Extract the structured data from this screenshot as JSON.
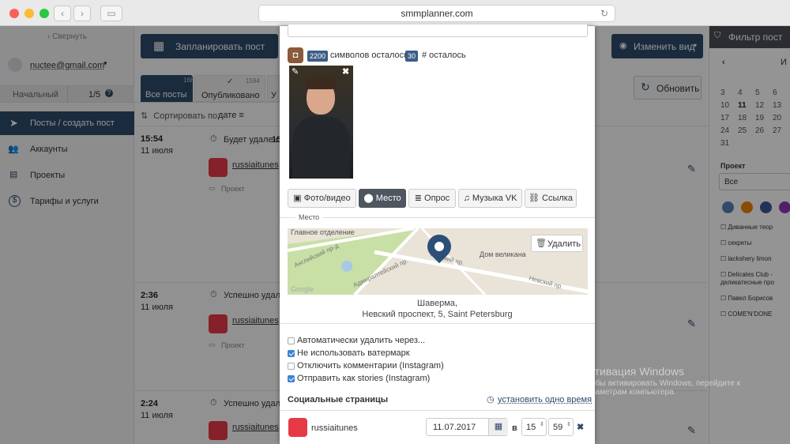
{
  "browser": {
    "url": "smmplanner.com"
  },
  "sidebar": {
    "collapse": "Свернуть",
    "account": "nuctee@gmail.com",
    "plan": "Начальный",
    "plan_count": "1/5",
    "nav": [
      {
        "label": "Посты / создать пост"
      },
      {
        "label": "Аккаунты"
      },
      {
        "label": "Проекты"
      },
      {
        "label": "Тарифы и услуги"
      }
    ]
  },
  "main": {
    "schedule_button": "Запланировать пост",
    "change_view": "Изменить вид",
    "refresh": "Обновить",
    "tabs": [
      {
        "label": "Все посты",
        "count": "1681"
      },
      {
        "label": "Опубликовано",
        "count": "1594"
      },
      {
        "label": "У"
      }
    ],
    "sort_label": "Сортировать по:",
    "sort_value": "дате",
    "posts": [
      {
        "time": "15:54",
        "date": "11 июля",
        "status": "Будет удален",
        "status_extra": "15",
        "account": "russiaitunes",
        "project": "Проект"
      },
      {
        "time": "2:36",
        "date": "11 июля",
        "status": "Успешно удален",
        "account": "russiaitunes",
        "project": "Проект"
      },
      {
        "time": "2:24",
        "date": "11 июля",
        "status": "Успешно удален",
        "account": "russiaitunes",
        "project": "Проект"
      }
    ]
  },
  "right_panel": {
    "title": "Фильтр пост",
    "month_initial": "И",
    "calendar_rows": [
      [
        "3",
        "4",
        "5",
        "6"
      ],
      [
        "10",
        "11",
        "12",
        "13"
      ],
      [
        "17",
        "18",
        "19",
        "20"
      ],
      [
        "24",
        "25",
        "26",
        "27"
      ],
      [
        "31",
        "",
        "",
        ""
      ]
    ],
    "project_label": "Проект",
    "project_value": "Все",
    "accounts": [
      "Диванные теор",
      "секреты",
      "lackshery limon",
      "Delicates Club - деликатесные про",
      "Павел Борисов",
      "COME'N'DONE"
    ]
  },
  "modal": {
    "chars_left_count": "2200",
    "chars_left_label": "символов осталось",
    "hashtags_count": "30",
    "hashtags_label": "# осталось",
    "tabs": [
      {
        "label": "Фото/видео",
        "icon": "image-icon"
      },
      {
        "label": "Место",
        "icon": "pin-icon"
      },
      {
        "label": "Опрос",
        "icon": "list-icon"
      },
      {
        "label": "Музыка VK",
        "icon": "music-icon"
      },
      {
        "label": "Ссылка",
        "icon": "link-icon"
      }
    ],
    "place_legend": "Место",
    "map": {
      "label1": "Главное отделение",
      "label2": "Дом великана",
      "street1": "Невский пр.",
      "street2": "Невский пр.",
      "street3": "Адмиралтейский пр.",
      "street4": "Английский пр-д",
      "delete": "Удалить",
      "google": "Google"
    },
    "place_name": "Шаверма,",
    "place_address": "Невский проспект, 5, Saint Petersburg",
    "options": [
      {
        "label": "Автоматически удалить через...",
        "checked": false
      },
      {
        "label": "Не использовать ватермарк",
        "checked": true
      },
      {
        "label": "Отключить комментарии (Instagram)",
        "checked": false
      },
      {
        "label": "Отправить как stories (Instagram)",
        "checked": true
      }
    ],
    "social_title": "Социальные страницы",
    "set_time": "установить одно время",
    "account_name": "russiaitunes",
    "date_value": "11.07.2017",
    "at": "в",
    "hour": "15",
    "minute": "59"
  },
  "watermark": {
    "line1": "Активация Windows",
    "line2": "Чтобы активировать Windows, перейдите к",
    "line3": "параметрам компьютера."
  },
  "colors": {
    "primary": "#2e4a6b",
    "badge": "#3c5d87",
    "instagram": "#8a5a3c",
    "map_pin": "#2c4f78"
  }
}
